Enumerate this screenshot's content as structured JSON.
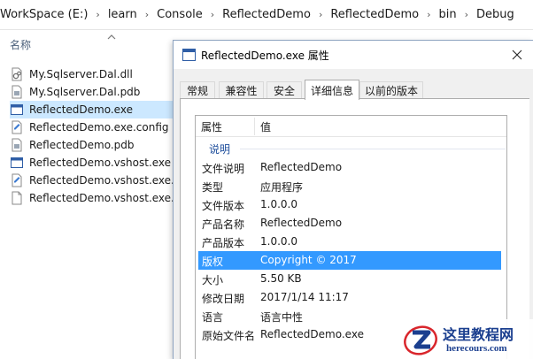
{
  "breadcrumb": [
    "WorkSpace (E:)",
    "learn",
    "Console",
    "ReflectedDemo",
    "ReflectedDemo",
    "bin",
    "Debug"
  ],
  "file_list": {
    "column_name": "名称",
    "files": [
      {
        "name": "My.Sqlserver.Dal.dll",
        "icon": "dll-file-icon"
      },
      {
        "name": "My.Sqlserver.Dal.pdb",
        "icon": "pdb-file-icon"
      },
      {
        "name": "ReflectedDemo.exe",
        "icon": "exe-file-icon",
        "selected": true
      },
      {
        "name": "ReflectedDemo.exe.config",
        "icon": "config-file-icon"
      },
      {
        "name": "ReflectedDemo.pdb",
        "icon": "pdb-file-icon"
      },
      {
        "name": "ReflectedDemo.vshost.exe",
        "icon": "exe-file-icon"
      },
      {
        "name": "ReflectedDemo.vshost.exe.co",
        "icon": "config-file-icon"
      },
      {
        "name": "ReflectedDemo.vshost.exe.m",
        "icon": "file-icon"
      }
    ]
  },
  "dialog": {
    "title": "ReflectedDemo.exe 属性",
    "tabs": [
      {
        "label": "常规"
      },
      {
        "label": "兼容性"
      },
      {
        "label": "安全"
      },
      {
        "label": "详细信息",
        "active": true
      },
      {
        "label": "以前的版本"
      }
    ],
    "details": {
      "header_property": "属性",
      "header_value": "值",
      "group": "说明",
      "rows": [
        {
          "name": "文件说明",
          "value": "ReflectedDemo"
        },
        {
          "name": "类型",
          "value": "应用程序"
        },
        {
          "name": "文件版本",
          "value": "1.0.0.0"
        },
        {
          "name": "产品名称",
          "value": "ReflectedDemo"
        },
        {
          "name": "产品版本",
          "value": "1.0.0.0"
        },
        {
          "name": "版权",
          "value": "Copyright ©  2017",
          "selected": true
        },
        {
          "name": "大小",
          "value": "5.50 KB"
        },
        {
          "name": "修改日期",
          "value": "2017/1/14 11:17"
        },
        {
          "name": "语言",
          "value": "语言中性"
        },
        {
          "name": "原始文件名",
          "value": "ReflectedDemo.exe"
        }
      ]
    }
  },
  "watermark": {
    "name": "这里教程网",
    "site": "herecours.com"
  },
  "colors": {
    "selection": "#3399ff",
    "explorer_selection": "#cce8ff",
    "watermark_blue": "#1b3f8f",
    "watermark_red": "#d9262c"
  }
}
